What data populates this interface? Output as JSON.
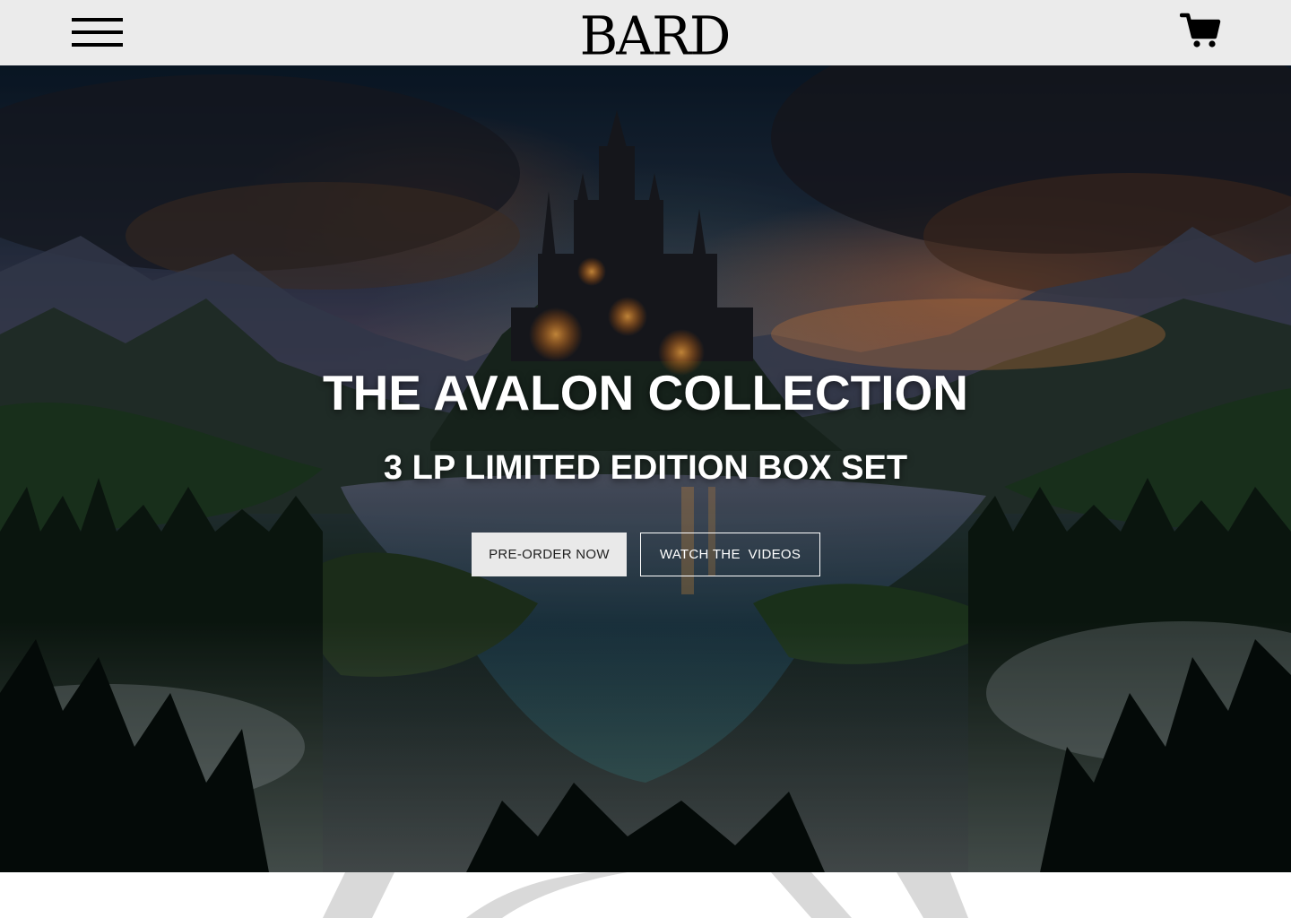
{
  "header": {
    "logo_text": "BARD",
    "menu_icon": "hamburger-menu-icon",
    "cart_icon": "shopping-cart-icon",
    "background": "#ebebeb"
  },
  "hero": {
    "title": "THE AVALON COLLECTION",
    "subtitle": "3 LP LIMITED EDITION BOX SET",
    "primary_button": "PRE-ORDER NOW",
    "secondary_button": "WATCH THE  VIDEOS",
    "image_description_icon": "fantasy-castle-landscape-image"
  },
  "colors": {
    "primary_button_bg": "#e9e9e9",
    "text_light": "#ffffff",
    "text_dark": "#000000"
  }
}
